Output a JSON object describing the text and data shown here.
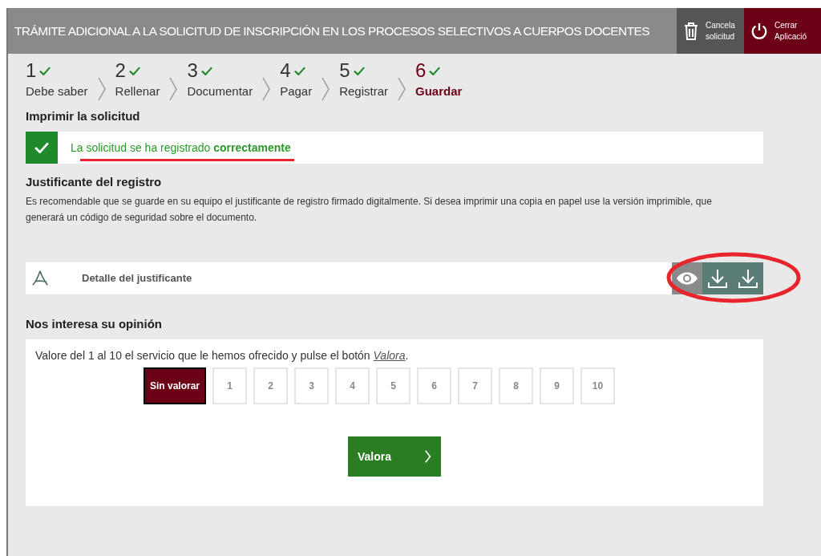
{
  "header": {
    "title": "TRÁMITE ADICIONAL A LA SOLICITUD DE INSCRIPCIÓN EN LOS PROCESOS SELECTIVOS A CUERPOS DOCENTES",
    "actions": [
      {
        "kind": "cancel",
        "lines": [
          "Cancela",
          "solicitud"
        ]
      },
      {
        "kind": "close",
        "lines": [
          "Cerrar",
          "Aplicació"
        ]
      }
    ]
  },
  "steps": [
    {
      "number": "1",
      "label": "Debe saber",
      "done": true,
      "selected": false
    },
    {
      "number": "2",
      "label": "Rellenar",
      "done": true,
      "selected": false
    },
    {
      "number": "3",
      "label": "Documentar",
      "done": true,
      "selected": false
    },
    {
      "number": "4",
      "label": "Pagar",
      "done": true,
      "selected": false
    },
    {
      "number": "5",
      "label": "Registrar",
      "done": true,
      "selected": false
    },
    {
      "number": "6",
      "label": "Guardar",
      "done": true,
      "selected": true
    }
  ],
  "print_section": {
    "heading": "Imprimir la solicitud",
    "message": "La solicitud se ha registrado **correctamente**"
  },
  "receipt": {
    "heading": "Justificante del registro",
    "description": "Es recomendable que se guarde en su equipo el justificante de registro firmado digitalmente. Si desea imprimir una copia en papel use la versión imprimible, que generará un código de seguridad sobre el documento.",
    "document": "Detalle del justificante",
    "actions": [
      {
        "kind": "view"
      },
      {
        "kind": "download"
      },
      {
        "kind": "download"
      }
    ]
  },
  "opinion": {
    "heading": "Nos interesa su opinión",
    "prompt_before": "Valore del 1 al 10 el servicio que le hemos ofrecido y pulse el botón ",
    "prompt_link": "Valora",
    "prompt_after": ".",
    "ratings": [
      {
        "label": "Sin valorar",
        "selected": true
      },
      {
        "label": "1",
        "selected": false
      },
      {
        "label": "2",
        "selected": false
      },
      {
        "label": "3",
        "selected": false
      },
      {
        "label": "4",
        "selected": false
      },
      {
        "label": "5",
        "selected": false
      },
      {
        "label": "6",
        "selected": false
      },
      {
        "label": "7",
        "selected": false
      },
      {
        "label": "8",
        "selected": false
      },
      {
        "label": "9",
        "selected": false
      },
      {
        "label": "10",
        "selected": false
      }
    ],
    "submit": "Valora"
  }
}
